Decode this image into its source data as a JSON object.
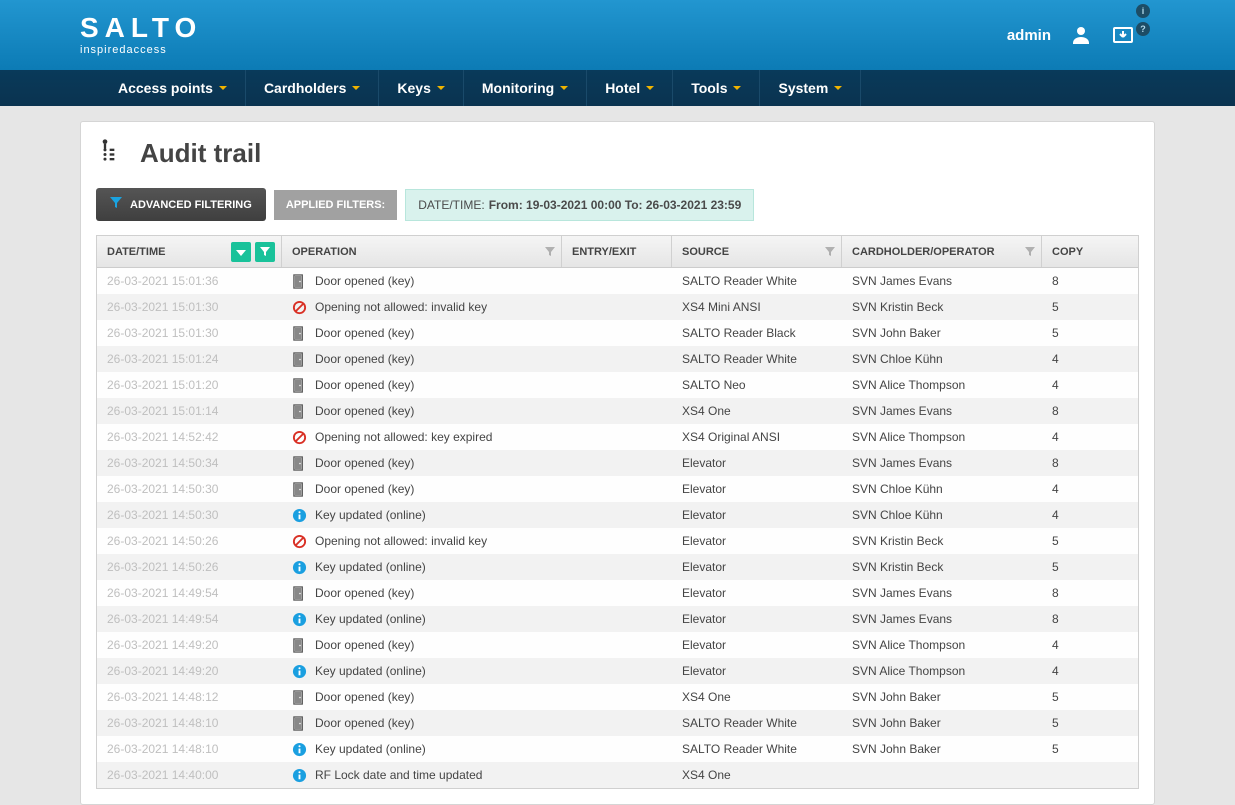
{
  "brand": {
    "name": "SALTO",
    "tagline": "inspiredaccess"
  },
  "header": {
    "user": "admin"
  },
  "nav": [
    "Access points",
    "Cardholders",
    "Keys",
    "Monitoring",
    "Hotel",
    "Tools",
    "System"
  ],
  "page": {
    "title": "Audit trail",
    "adv_filter_btn": "ADVANCED FILTERING",
    "applied_filters_label": "APPLIED FILTERS:",
    "applied_filter": {
      "label": "DATE/TIME:",
      "value": "From: 19-03-2021 00:00 To: 26-03-2021 23:59"
    }
  },
  "columns": {
    "date": "DATE/TIME",
    "operation": "OPERATION",
    "entry": "ENTRY/EXIT",
    "source": "SOURCE",
    "cardholder": "CARDHOLDER/OPERATOR",
    "copy": "COPY"
  },
  "icon_types": {
    "door": "door-icon",
    "prohibited": "prohibited-icon",
    "info": "info-icon"
  },
  "rows": [
    {
      "dt": "26-03-2021 15:01:36",
      "icon": "door",
      "op": "Door opened (key)",
      "entry": "",
      "src": "SALTO Reader White",
      "card": "SVN James Evans",
      "copy": "8"
    },
    {
      "dt": "26-03-2021 15:01:30",
      "icon": "prohibited",
      "op": "Opening not allowed: invalid key",
      "entry": "",
      "src": "XS4 Mini ANSI",
      "card": "SVN Kristin Beck",
      "copy": "5"
    },
    {
      "dt": "26-03-2021 15:01:30",
      "icon": "door",
      "op": "Door opened (key)",
      "entry": "",
      "src": "SALTO Reader Black",
      "card": "SVN John Baker",
      "copy": "5"
    },
    {
      "dt": "26-03-2021 15:01:24",
      "icon": "door",
      "op": "Door opened (key)",
      "entry": "",
      "src": "SALTO Reader White",
      "card": "SVN Chloe Kühn",
      "copy": "4"
    },
    {
      "dt": "26-03-2021 15:01:20",
      "icon": "door",
      "op": "Door opened (key)",
      "entry": "",
      "src": "SALTO Neo",
      "card": "SVN Alice Thompson",
      "copy": "4"
    },
    {
      "dt": "26-03-2021 15:01:14",
      "icon": "door",
      "op": "Door opened (key)",
      "entry": "",
      "src": "XS4 One",
      "card": "SVN James Evans",
      "copy": "8"
    },
    {
      "dt": "26-03-2021 14:52:42",
      "icon": "prohibited",
      "op": "Opening not allowed: key expired",
      "entry": "",
      "src": "XS4 Original ANSI",
      "card": "SVN Alice Thompson",
      "copy": "4"
    },
    {
      "dt": "26-03-2021 14:50:34",
      "icon": "door",
      "op": "Door opened (key)",
      "entry": "",
      "src": "Elevator",
      "card": "SVN James Evans",
      "copy": "8"
    },
    {
      "dt": "26-03-2021 14:50:30",
      "icon": "door",
      "op": "Door opened (key)",
      "entry": "",
      "src": "Elevator",
      "card": "SVN Chloe Kühn",
      "copy": "4"
    },
    {
      "dt": "26-03-2021 14:50:30",
      "icon": "info",
      "op": "Key updated (online)",
      "entry": "",
      "src": "Elevator",
      "card": "SVN Chloe Kühn",
      "copy": "4"
    },
    {
      "dt": "26-03-2021 14:50:26",
      "icon": "prohibited",
      "op": "Opening not allowed: invalid key",
      "entry": "",
      "src": "Elevator",
      "card": "SVN Kristin Beck",
      "copy": "5"
    },
    {
      "dt": "26-03-2021 14:50:26",
      "icon": "info",
      "op": "Key updated (online)",
      "entry": "",
      "src": "Elevator",
      "card": "SVN Kristin Beck",
      "copy": "5"
    },
    {
      "dt": "26-03-2021 14:49:54",
      "icon": "door",
      "op": "Door opened (key)",
      "entry": "",
      "src": "Elevator",
      "card": "SVN James Evans",
      "copy": "8"
    },
    {
      "dt": "26-03-2021 14:49:54",
      "icon": "info",
      "op": "Key updated (online)",
      "entry": "",
      "src": "Elevator",
      "card": "SVN James Evans",
      "copy": "8"
    },
    {
      "dt": "26-03-2021 14:49:20",
      "icon": "door",
      "op": "Door opened (key)",
      "entry": "",
      "src": "Elevator",
      "card": "SVN Alice Thompson",
      "copy": "4"
    },
    {
      "dt": "26-03-2021 14:49:20",
      "icon": "info",
      "op": "Key updated (online)",
      "entry": "",
      "src": "Elevator",
      "card": "SVN Alice Thompson",
      "copy": "4"
    },
    {
      "dt": "26-03-2021 14:48:12",
      "icon": "door",
      "op": "Door opened (key)",
      "entry": "",
      "src": "XS4 One",
      "card": "SVN John Baker",
      "copy": "5"
    },
    {
      "dt": "26-03-2021 14:48:10",
      "icon": "door",
      "op": "Door opened (key)",
      "entry": "",
      "src": "SALTO Reader White",
      "card": "SVN John Baker",
      "copy": "5"
    },
    {
      "dt": "26-03-2021 14:48:10",
      "icon": "info",
      "op": "Key updated (online)",
      "entry": "",
      "src": "SALTO Reader White",
      "card": "SVN John Baker",
      "copy": "5"
    },
    {
      "dt": "26-03-2021 14:40:00",
      "icon": "info",
      "op": "RF Lock date and time updated",
      "entry": "",
      "src": "XS4 One",
      "card": "",
      "copy": ""
    }
  ]
}
